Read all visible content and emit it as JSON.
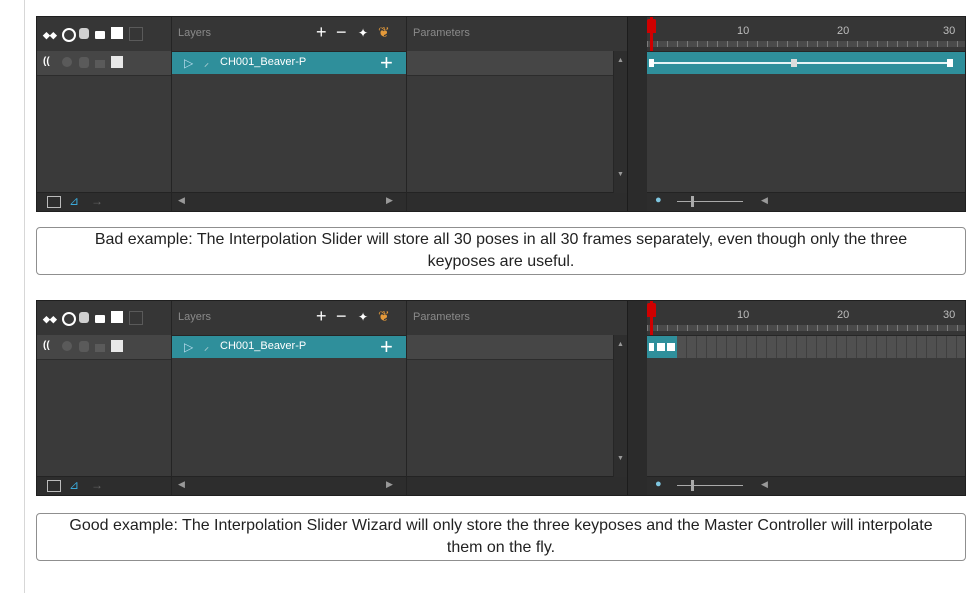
{
  "panels": [
    {
      "header": {
        "layers_label": "Layers",
        "parameters_label": "Parameters"
      },
      "layer": {
        "name": "CH001_Beaver-P"
      },
      "timeline": {
        "ticks": [
          "10",
          "20",
          "30"
        ],
        "track_mode": "interpolated",
        "keyframes_at": [
          1,
          15,
          30
        ]
      }
    },
    {
      "header": {
        "layers_label": "Layers",
        "parameters_label": "Parameters"
      },
      "layer": {
        "name": "CH001_Beaver-P"
      },
      "timeline": {
        "ticks": [
          "10",
          "20",
          "30"
        ],
        "track_mode": "keyposes_only",
        "keyframes_at": [
          1,
          2,
          3
        ]
      }
    }
  ],
  "captions": {
    "bad": "Bad example: The Interpolation Slider will store all 30 poses in all 30 frames separately, even though only the three keyposes are useful.",
    "good": "Good example: The Interpolation Slider Wizard will only store the three keyposes and the Master Controller will interpolate them on the fly."
  },
  "colors": {
    "panel_bg": "#3a3a3a",
    "layer_selected": "#2f8f9b",
    "playhead": "#d00000"
  },
  "icons": [
    "animate-mode-icon",
    "enable-icon",
    "database-icon",
    "lock-icon",
    "color-swatch-icon",
    "add-layer-icon",
    "remove-layer-icon",
    "add-peg-icon",
    "create-layer-icon",
    "zoom-icon",
    "slider-icon"
  ]
}
